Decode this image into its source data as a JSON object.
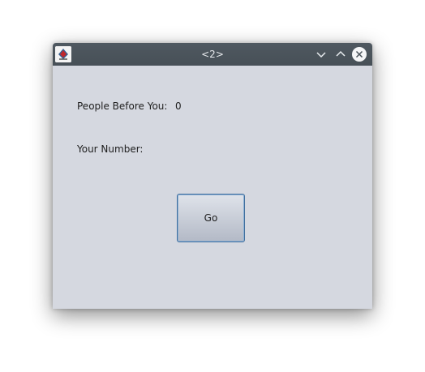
{
  "window": {
    "title": "<2>"
  },
  "main": {
    "people_before_label": "People Before You:",
    "people_before_value": "0",
    "your_number_label": "Your Number:",
    "your_number_value": "",
    "go_button_label": "Go"
  },
  "icons": {
    "app": "java-app-icon",
    "minimize": "chevron-down-icon",
    "maximize": "chevron-up-icon",
    "close": "close-icon"
  },
  "colors": {
    "titlebar": "#4b545b",
    "window_bg": "#d5d8e0",
    "button_border": "#3f6f9f"
  }
}
